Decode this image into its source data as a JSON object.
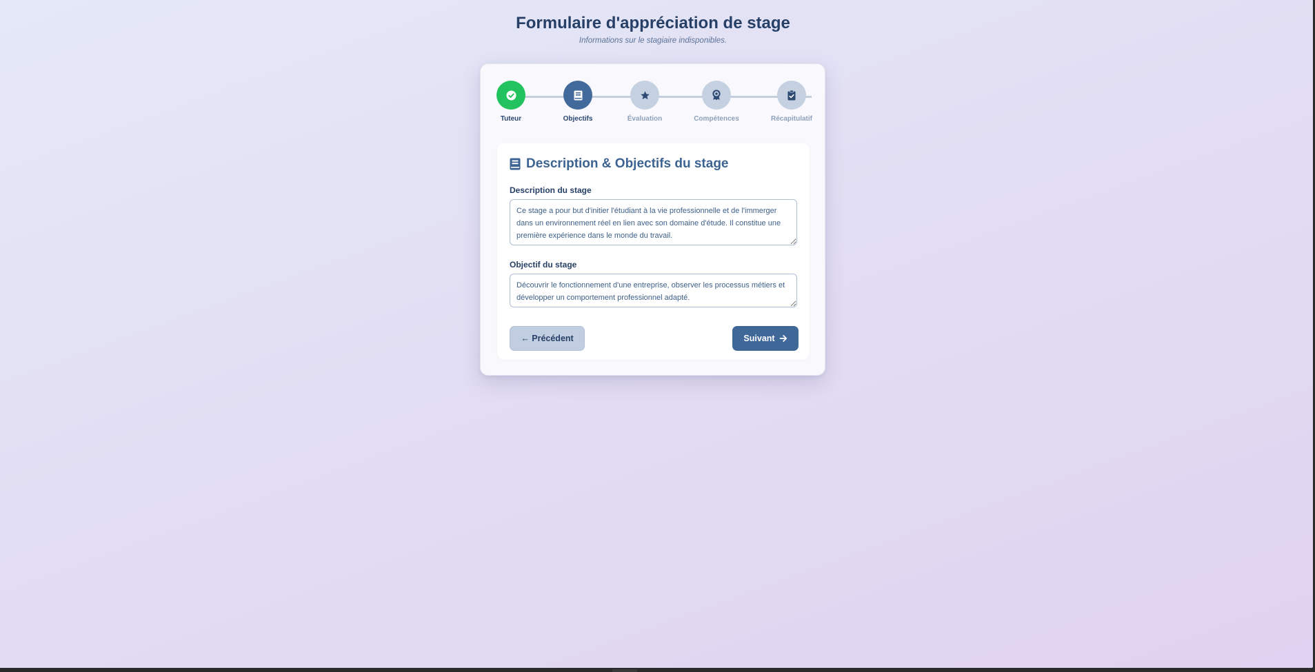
{
  "header": {
    "title": "Formulaire d'appréciation de stage",
    "subtitle": "Informations sur le stagiaire indisponibles."
  },
  "stepper": {
    "steps": [
      {
        "label": "Tuteur",
        "state": "done",
        "icon": "check-icon"
      },
      {
        "label": "Objectifs",
        "state": "active",
        "icon": "book-icon"
      },
      {
        "label": "Évaluation",
        "state": "pending",
        "icon": "star-icon"
      },
      {
        "label": "Compétences",
        "state": "pending",
        "icon": "award-icon"
      },
      {
        "label": "Récapitulatif",
        "state": "pending",
        "icon": "clipboard-check-icon"
      }
    ],
    "current_step": 2,
    "total_steps": 5
  },
  "section": {
    "heading": "Description & Objectifs du stage",
    "icon": "book-icon"
  },
  "fields": {
    "description": {
      "label": "Description du stage",
      "value": "Ce stage a pour but d'initier l'étudiant à la vie professionnelle et de l'immerger dans un environnement réel en lien avec son domaine d'étude. Il constitue une première expérience dans le monde du travail."
    },
    "objective": {
      "label": "Objectif du stage",
      "value": "Découvrir le fonctionnement d'une entreprise, observer les processus métiers et développer un comportement professionnel adapté."
    }
  },
  "buttons": {
    "previous": "← Précédent",
    "next": "Suivant"
  },
  "colors": {
    "done": "#22c35e",
    "active": "#41699a",
    "pending": "#c5d0e1",
    "title": "#263f66",
    "accent": "#3c6391"
  }
}
